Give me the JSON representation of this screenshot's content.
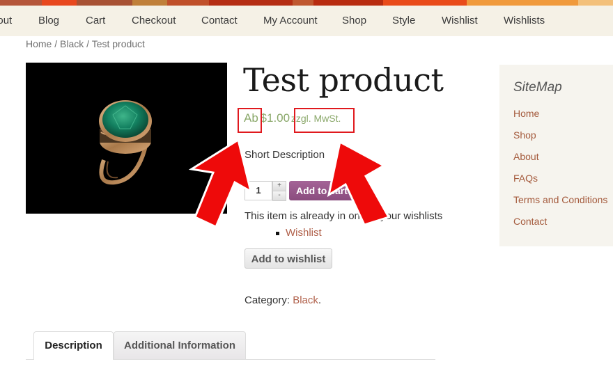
{
  "nav": {
    "items": [
      "About",
      "Blog",
      "Cart",
      "Checkout",
      "Contact",
      "My Account",
      "Shop",
      "Style",
      "Wishlist",
      "Wishlists"
    ]
  },
  "breadcrumb": {
    "home": "Home",
    "sep": " / ",
    "category": "Black",
    "current": "Test product"
  },
  "product": {
    "title": "Test product",
    "price_prefix": "Ab",
    "price": "$1.00",
    "price_suffix": "zzgl. MwSt.",
    "short_description": "Short Description",
    "quantity": "1",
    "qty_plus": "+",
    "qty_minus": "-",
    "add_to_cart_label": "Add to cart",
    "wishlist_notice": "This item is already in one of your wishlists",
    "wishlist_links": [
      "Wishlist"
    ],
    "add_to_wishlist_label": "Add to wishlist",
    "category_label": "Category:",
    "category_value": "Black",
    "category_end": "."
  },
  "tabs": [
    {
      "label": "Description",
      "active": true
    },
    {
      "label": "Additional Information",
      "active": false
    }
  ],
  "sidebar": {
    "title": "SiteMap",
    "links": [
      "Home",
      "Shop",
      "About",
      "FAQs",
      "Terms and Conditions",
      "Contact"
    ]
  },
  "colors": {
    "price_green": "#8aa86a",
    "link_brown": "#b0604a",
    "button_purple": "#a46497",
    "annotation_red": "#e0191e"
  }
}
